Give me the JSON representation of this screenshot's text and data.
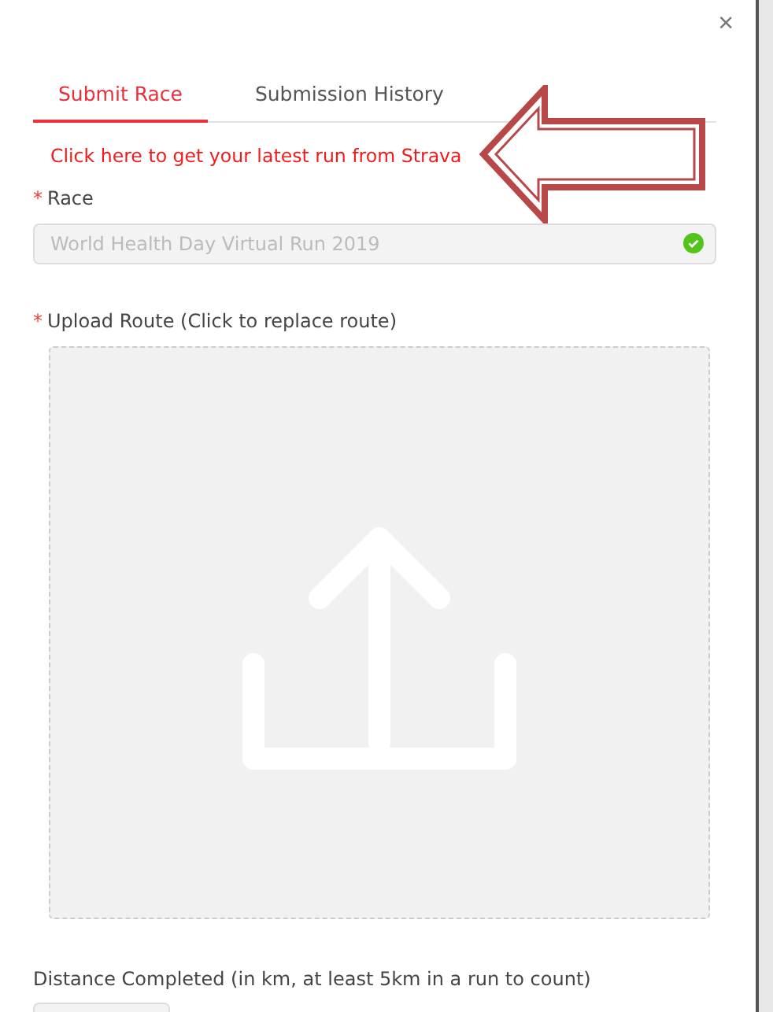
{
  "dialog": {
    "close": "×"
  },
  "tabs": [
    {
      "label": "Submit Race",
      "selected": true
    },
    {
      "label": "Submission History",
      "selected": false
    }
  ],
  "strava_link": "Click here to get your latest run from Strava",
  "race": {
    "mark": "*",
    "label": "Race",
    "value": "World Health Day Virtual Run 2019",
    "valid": true
  },
  "upload": {
    "mark": "*",
    "label": "Upload Route (Click to replace route)"
  },
  "distance": {
    "label": "Distance Completed (in km, at least 5km in a run to count)"
  }
}
